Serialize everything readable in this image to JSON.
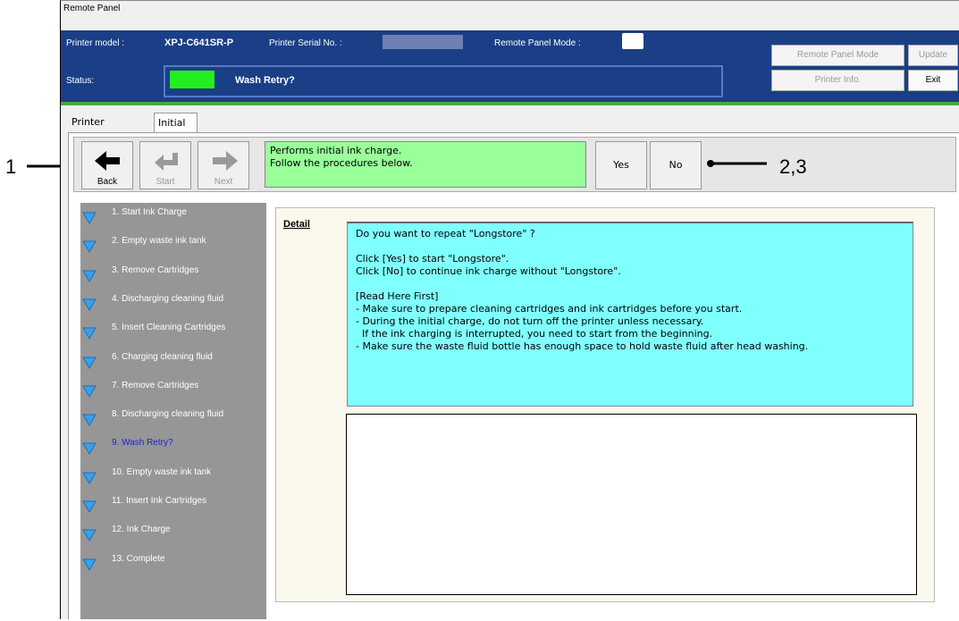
{
  "window": {
    "title": "Remote Panel"
  },
  "header": {
    "printer_model_label": "Printer model :",
    "printer_model_value": "XPJ-C641SR-P",
    "serial_label": "Printer Serial No. :",
    "mode_label": "Remote Panel Mode :",
    "status_label": "Status:",
    "status_text": "Wash Retry?",
    "status_color": "#22ee22"
  },
  "buttons": {
    "remote_panel_mode": "Remote Panel Mode",
    "update": "Update",
    "printer_info": "Printer Info.",
    "exit": "Exit"
  },
  "tabs": [
    {
      "label": "Printer Status"
    },
    {
      "label": "Initial Charge",
      "selected": true
    }
  ],
  "toolbar": {
    "back": "Back",
    "start": "Start",
    "next": "Next",
    "message_line1": "Performs initial ink charge.",
    "message_line2": "Follow the procedures below.",
    "yes": "Yes",
    "no": "No"
  },
  "steps": [
    "1. Start Ink Charge",
    "2. Empty waste ink tank",
    "3. Remove Cartridges",
    "4. Discharging cleaning fluid",
    "5. Insert Cleaning Cartridges",
    "6. Charging cleaning fluid",
    "7. Remove Cartridges",
    "8. Discharging cleaning fluid",
    "9. Wash Retry?",
    "10. Empty waste ink tank",
    "11. Insert Ink Cartridges",
    "12. Ink Charge",
    "13. Complete"
  ],
  "current_step_index": 8,
  "detail": {
    "label": "Detail",
    "lines": [
      "Do you want to repeat \"Longstore\" ?",
      "",
      "Click [Yes] to start \"Longstore\".",
      "Click [No] to continue ink charge without \"Longstore\".",
      "",
      "[Read Here First]",
      "- Make sure to prepare cleaning cartridges and ink cartridges before you start.",
      "- During the initial charge, do not turn off the printer unless necessary.",
      "  If the ink charging is interrupted, you need to start from the beginning.",
      "- Make sure the waste fluid bottle has enough space to hold waste fluid after head washing."
    ]
  },
  "callouts": {
    "left": "1",
    "right": "2,3"
  }
}
